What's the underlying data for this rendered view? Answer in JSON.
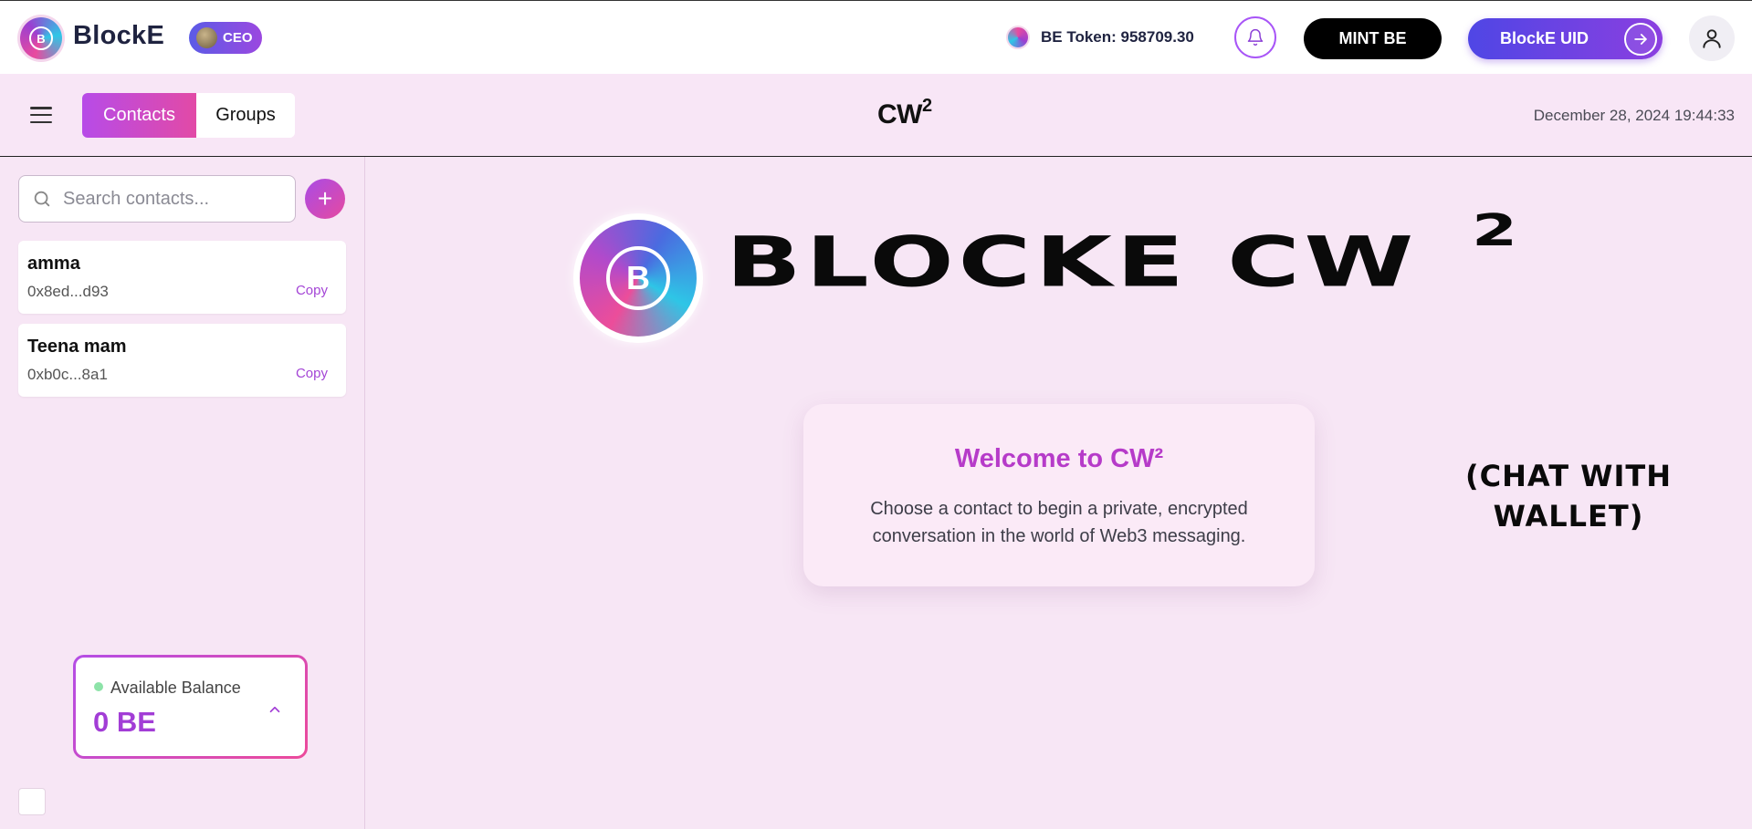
{
  "header": {
    "brand_name": "BlockE",
    "brand_logo_letter": "B",
    "role_badge": "CEO",
    "token_label": "BE Token: 958709.30",
    "mint_button": "MINT BE",
    "uid_button": "BlockE UID",
    "icons": {
      "notifications": "bell-icon",
      "uid_arrow": "arrow-right-icon",
      "profile": "user-icon",
      "menu": "hamburger-icon"
    }
  },
  "subheader": {
    "tabs": [
      {
        "label": "Contacts",
        "active": true
      },
      {
        "label": "Groups",
        "active": false
      }
    ],
    "title": "CW",
    "title_sup": "2",
    "datetime": "December 28, 2024 19:44:33"
  },
  "sidebar": {
    "search": {
      "placeholder": "Search contacts...",
      "value": ""
    },
    "add_button": "+",
    "contacts": [
      {
        "name": "amma",
        "address": "0x8ed...d93",
        "copy_label": "Copy"
      },
      {
        "name": "Teena mam",
        "address": "0xb0c...8a1",
        "copy_label": "Copy"
      }
    ],
    "balance": {
      "label": "Available Balance",
      "value": "0 BE",
      "status_color": "#8de3a8"
    }
  },
  "main": {
    "hero_title": "BLOCKE  CW",
    "hero_sup": "2",
    "hero_subtitle": "(CHAT WITH WALLET)",
    "welcome": {
      "title": "Welcome to CW²",
      "text": "Choose a contact to begin a private, encrypted conversation in the world of Web3 messaging."
    }
  },
  "colors": {
    "accent_purple": "#a855f7",
    "accent_pink": "#e24aa6",
    "background": "#f7e6f5",
    "uid_gradient_start": "#4f46e5"
  }
}
